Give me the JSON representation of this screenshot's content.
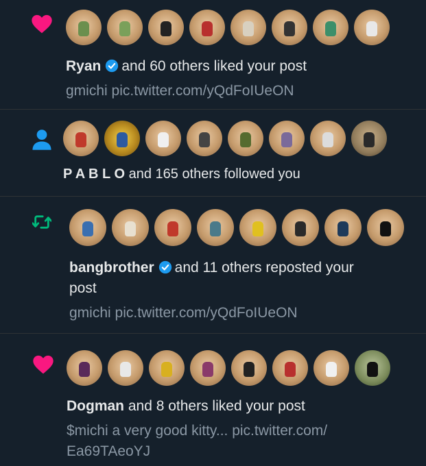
{
  "colors": {
    "background": "#15202b",
    "like": "#f91880",
    "follow": "#1d9bf0",
    "repost": "#00ba7c",
    "secondary_text": "#8b98a5",
    "verified": "#1d9bf0"
  },
  "notifications": [
    {
      "type": "like",
      "icon": "heart-icon",
      "user": "Ryan",
      "verified": true,
      "action": "and 60 others liked your post",
      "subtext": "gmichi pic.twitter.com/yQdFoIUeON",
      "avatar_count": 8
    },
    {
      "type": "follow",
      "icon": "person-icon",
      "user": "P A B L O",
      "verified": false,
      "action": "and 165 others followed you",
      "subtext": "",
      "avatar_count": 8
    },
    {
      "type": "repost",
      "icon": "repost-icon",
      "user": "bangbrother",
      "verified": true,
      "action": "and 11 others reposted your",
      "action_line2": "post",
      "subtext": "gmichi pic.twitter.com/yQdFoIUeON",
      "avatar_count": 8
    },
    {
      "type": "like",
      "icon": "heart-icon",
      "user": "Dogman",
      "verified": false,
      "action": "and 8 others liked your post",
      "subtext": "$michi a very good kitty... pic.twitter.com/",
      "subtext_line2": "Ea69TAeoYJ",
      "avatar_count": 8
    }
  ]
}
